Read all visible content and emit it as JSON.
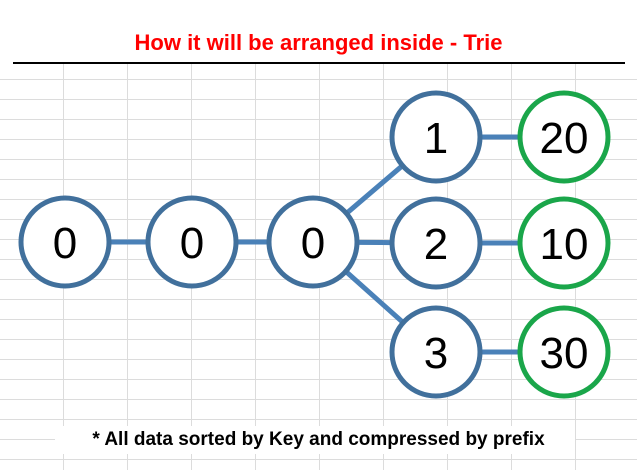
{
  "title": "How it will be arranged inside - Trie",
  "footnote": "* All data sorted by Key and compressed by prefix",
  "colors": {
    "title": "#ff0000",
    "key_node_border": "#41709c",
    "value_node_border": "#1aa64a",
    "edge": "#4a81b8"
  },
  "nodes": [
    {
      "id": "n0",
      "label": "0",
      "kind": "key"
    },
    {
      "id": "n1",
      "label": "0",
      "kind": "key"
    },
    {
      "id": "n2",
      "label": "0",
      "kind": "key"
    },
    {
      "id": "n3",
      "label": "1",
      "kind": "key"
    },
    {
      "id": "n4",
      "label": "2",
      "kind": "key"
    },
    {
      "id": "n5",
      "label": "3",
      "kind": "key"
    },
    {
      "id": "v1",
      "label": "20",
      "kind": "value"
    },
    {
      "id": "v2",
      "label": "10",
      "kind": "value"
    },
    {
      "id": "v3",
      "label": "30",
      "kind": "value"
    }
  ],
  "edges": [
    {
      "from": "n0",
      "to": "n1"
    },
    {
      "from": "n1",
      "to": "n2"
    },
    {
      "from": "n2",
      "to": "n3"
    },
    {
      "from": "n2",
      "to": "n4"
    },
    {
      "from": "n2",
      "to": "n5"
    },
    {
      "from": "n3",
      "to": "v1"
    },
    {
      "from": "n4",
      "to": "v2"
    },
    {
      "from": "n5",
      "to": "v3"
    }
  ]
}
